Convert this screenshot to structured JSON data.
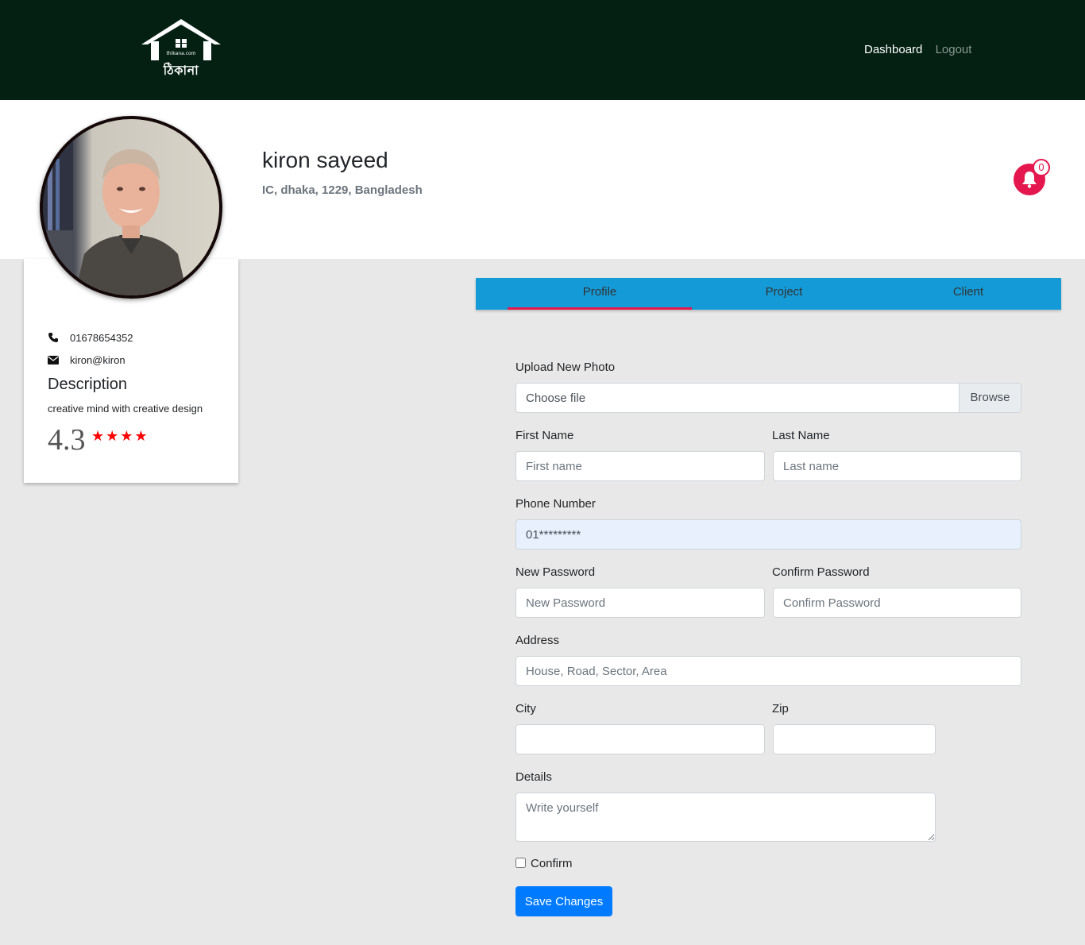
{
  "nav": {
    "logo_text": "ঠিকানা",
    "logo_small": "thikana.com",
    "dashboard": "Dashboard",
    "logout": "Logout"
  },
  "user": {
    "name": "kiron sayeed",
    "address": "IC, dhaka, 1229,  Bangladesh",
    "phone": "01678654352",
    "email": "kiron@kiron",
    "description_title": "Description",
    "description": "creative mind with creative design",
    "rating": "4.3",
    "rating_value": 4.3,
    "stars": "★★★★",
    "notifications": "0"
  },
  "tabs": [
    {
      "label": "Profile"
    },
    {
      "label": "Project"
    },
    {
      "label": "Client"
    }
  ],
  "form": {
    "upload_label": "Upload New Photo",
    "file_placeholder": "Choose file",
    "browse": "Browse",
    "first_name_label": "First Name",
    "first_name_placeholder": "First name",
    "last_name_label": "Last Name",
    "last_name_placeholder": "Last name",
    "phone_label": "Phone Number",
    "phone_value": "01*********",
    "new_password_label": "New Password",
    "new_password_placeholder": "New Password",
    "confirm_password_label": "Confirm Password",
    "confirm_password_placeholder": "Confirm Password",
    "address_label": "Address",
    "address_placeholder": "House, Road, Sector, Area",
    "city_label": "City",
    "city_value": "",
    "zip_label": "Zip",
    "zip_value": "",
    "details_label": "Details",
    "details_placeholder": "Write yourself",
    "confirm_label": "Confirm",
    "save_button": "Save Changes"
  },
  "colors": {
    "navbar": "#032013",
    "tab_bar": "#149ad7",
    "tab_active": "#e5174f",
    "bell": "#e5174f",
    "primary_button": "#007bff",
    "stars": "#ff0000"
  }
}
